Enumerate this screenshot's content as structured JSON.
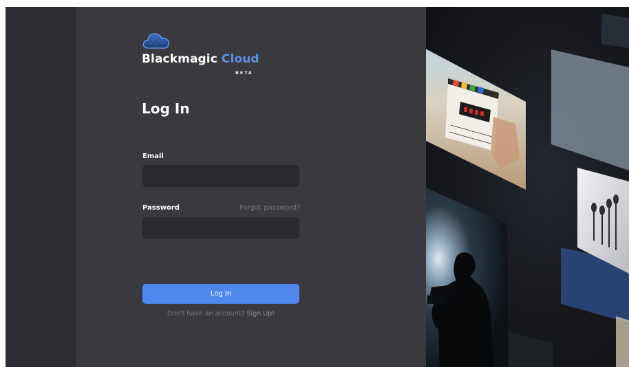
{
  "brand": {
    "name_part1": "Blackmagic ",
    "name_part2": "Cloud",
    "badge": "BETA",
    "accent_color": "#5b8fe0"
  },
  "form": {
    "title": "Log In",
    "email_label": "Email",
    "email_value": "",
    "password_label": "Password",
    "password_value": "",
    "forgot_link": "Forgot password?",
    "submit_label": "Log In",
    "signup_prompt": "Don't have an account?",
    "signup_link": "Sign Up!",
    "button_color": "#4f87ee"
  },
  "decoration": {
    "icon": "cloud-icon",
    "art": "tilted photo cards: film clapperboard, silhouetted camera operator, studio microphones"
  }
}
